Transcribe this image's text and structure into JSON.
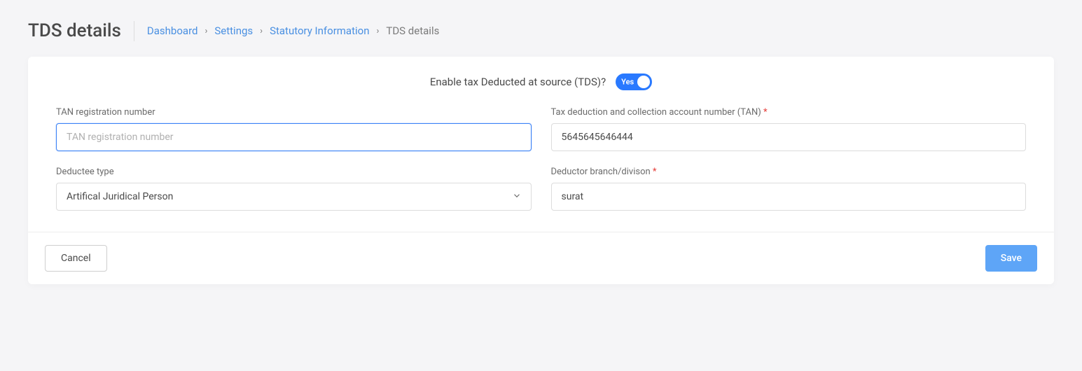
{
  "page": {
    "title": "TDS details"
  },
  "breadcrumb": {
    "items": [
      "Dashboard",
      "Settings",
      "Statutory Information"
    ],
    "current": "TDS details"
  },
  "toggle": {
    "label": "Enable tax Deducted at source (TDS)?",
    "state_text": "Yes"
  },
  "fields": {
    "tan_reg": {
      "label": "TAN registration number",
      "placeholder": "TAN registration number",
      "value": ""
    },
    "tan_account": {
      "label": "Tax deduction and collection account number (TAN) ",
      "required_mark": "*",
      "value": "5645645646444"
    },
    "deductee_type": {
      "label": "Deductee type",
      "value": "Artifical Juridical Person"
    },
    "deductor_branch": {
      "label": "Deductor branch/divison ",
      "required_mark": "*",
      "value": "surat"
    }
  },
  "buttons": {
    "cancel": "Cancel",
    "save": "Save"
  }
}
